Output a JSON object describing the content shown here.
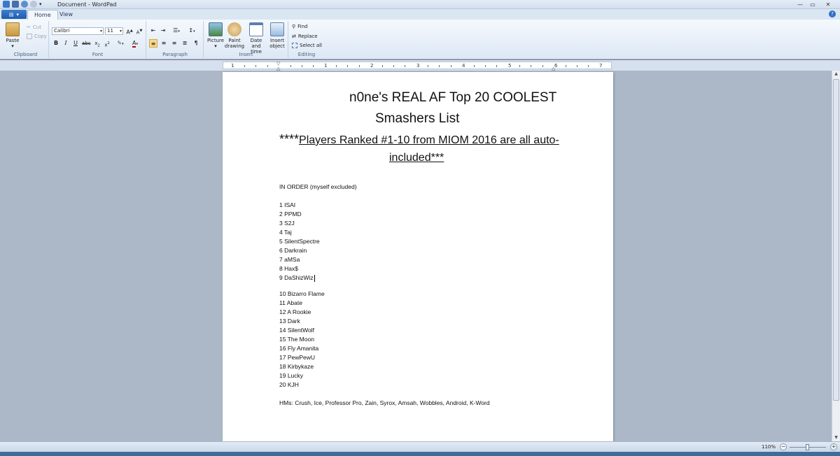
{
  "window": {
    "title": "Document - WordPad"
  },
  "tabs": [
    {
      "label": "Home"
    },
    {
      "label": "View"
    }
  ],
  "ribbon": {
    "clipboard": {
      "label": "Clipboard",
      "paste": "Paste",
      "cut": "Cut",
      "copy": "Copy"
    },
    "font": {
      "label": "Font",
      "family": "Calibri",
      "size": "11"
    },
    "paragraph": {
      "label": "Paragraph"
    },
    "insert": {
      "label": "Insert",
      "picture": "Picture",
      "paint_1": "Paint",
      "paint_2": "drawing",
      "date_1": "Date and",
      "date_2": "time",
      "obj_1": "Insert",
      "obj_2": "object"
    },
    "editing": {
      "label": "Editing",
      "find": "Find",
      "replace": "Replace",
      "select_all": "Select all"
    }
  },
  "ruler": {
    "numbers": [
      "1",
      "1",
      "2",
      "3",
      "4",
      "5",
      "6",
      "7"
    ]
  },
  "document": {
    "title_line1": "n0ne's REAL AF Top 20 COOLEST",
    "title_line2": "Smashers List",
    "sub_stars": "****",
    "sub_line1": "Players Ranked #1-10 from MIOM 2016 are all auto-",
    "sub_line2": "included***",
    "intro": "IN ORDER (myself excluded)",
    "list_top": [
      "1 ISAI",
      "2 PPMD",
      "3 S2J",
      "4 Taj",
      "5 SilentSpectre",
      "6 Darkrain",
      "7 aMSa",
      "8 Hax$",
      "9 DaShizWiz"
    ],
    "list_rest": [
      "10 Bizarro Flame",
      "11 Abate",
      "12 A Rookie",
      "13 Dark",
      "14 SilentWolf",
      "15 The Moon",
      "16 Fly Amanita",
      "17 PewPewU",
      "18 Kirbykaze",
      "19 Lucky",
      "20 KJH"
    ],
    "hms": "HMs: Crush, Ice, Professor Pro, Zain, Syrox, Amsah, Wobbles, Android, K-Word"
  },
  "status": {
    "zoom": "110%"
  }
}
